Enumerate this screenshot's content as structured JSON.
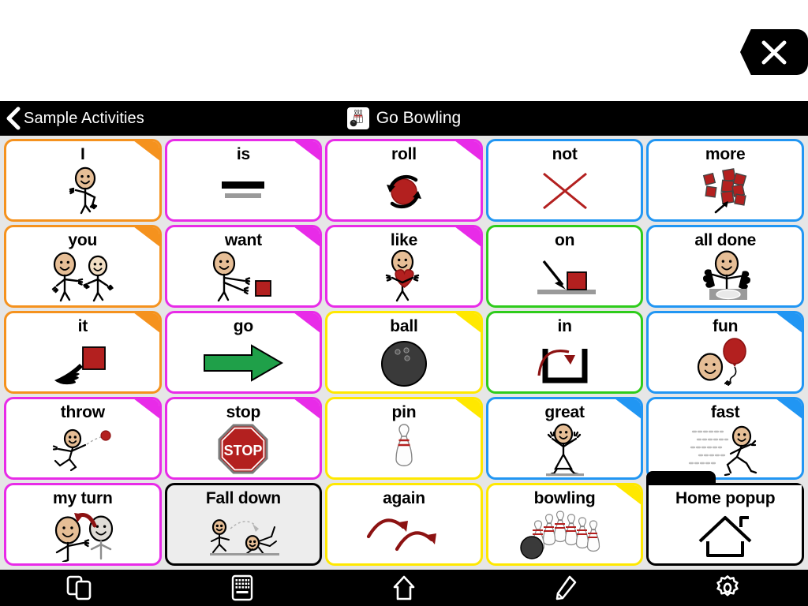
{
  "window": {
    "close_label": "close-icon"
  },
  "header": {
    "back_label": "Sample Activities",
    "back_icon": "chevron-left-icon",
    "title": "Go Bowling",
    "title_icon": "bowling-pins-icon"
  },
  "colors": {
    "orange": "#F5921E",
    "magenta": "#E82BE8",
    "blue": "#2196F3",
    "green": "#2ECC1B",
    "yellow": "#FFE800",
    "black": "#000000",
    "page_background": "#E6E6E6",
    "red": "#B3201F",
    "dark_red": "#8C1212"
  },
  "grid": {
    "rows": 5,
    "columns": 5,
    "cells": [
      {
        "label": "I",
        "border": "#F5921E",
        "fold": "#F5921E",
        "icon": "person-pointing-self-icon"
      },
      {
        "label": "is",
        "border": "#E82BE8",
        "fold": "#E82BE8",
        "icon": "equals-bars-icon"
      },
      {
        "label": "roll",
        "border": "#E82BE8",
        "fold": "#E82BE8",
        "icon": "rolling-ball-arrows-icon"
      },
      {
        "label": "not",
        "border": "#2196F3",
        "fold": null,
        "icon": "red-x-icon"
      },
      {
        "label": "more",
        "border": "#2196F3",
        "fold": null,
        "icon": "blocks-pile-arrow-icon"
      },
      {
        "label": "you",
        "border": "#F5921E",
        "fold": "#F5921E",
        "icon": "two-people-pointing-icon"
      },
      {
        "label": "want",
        "border": "#E82BE8",
        "fold": "#E82BE8",
        "icon": "person-reaching-block-icon"
      },
      {
        "label": "like",
        "border": "#E82BE8",
        "fold": "#E82BE8",
        "icon": "person-hugging-heart-icon"
      },
      {
        "label": "on",
        "border": "#2ECC1B",
        "fold": null,
        "icon": "arrow-onto-block-icon"
      },
      {
        "label": "all done",
        "border": "#2196F3",
        "fold": null,
        "icon": "person-hands-up-plate-icon"
      },
      {
        "label": "it",
        "border": "#F5921E",
        "fold": "#F5921E",
        "icon": "hand-pointing-block-icon"
      },
      {
        "label": "go",
        "border": "#E82BE8",
        "fold": "#E82BE8",
        "icon": "green-arrow-right-icon"
      },
      {
        "label": "ball",
        "border": "#FFE800",
        "fold": "#FFE800",
        "icon": "bowling-ball-icon"
      },
      {
        "label": "in",
        "border": "#2ECC1B",
        "fold": null,
        "icon": "arrow-into-container-icon"
      },
      {
        "label": "fun",
        "border": "#2196F3",
        "fold": "#2196F3",
        "icon": "face-balloon-icon"
      },
      {
        "label": "throw",
        "border": "#E82BE8",
        "fold": "#E82BE8",
        "icon": "person-throwing-ball-icon"
      },
      {
        "label": "stop",
        "border": "#E82BE8",
        "fold": "#E82BE8",
        "icon": "stop-sign-icon"
      },
      {
        "label": "pin",
        "border": "#FFE800",
        "fold": "#FFE800",
        "icon": "bowling-pin-icon"
      },
      {
        "label": "great",
        "border": "#2196F3",
        "fold": "#2196F3",
        "icon": "person-cheering-icon"
      },
      {
        "label": "fast",
        "border": "#2196F3",
        "fold": "#2196F3",
        "icon": "person-running-fast-icon"
      },
      {
        "label": "my turn",
        "border": "#E82BE8",
        "fold": null,
        "icon": "person-pointing-self-arrow-icon"
      },
      {
        "label": "Fall down",
        "border": "#000000",
        "fold": null,
        "icon": "person-falling-icon",
        "style": "pressed"
      },
      {
        "label": "again",
        "border": "#FFE800",
        "fold": null,
        "icon": "repeat-arrows-icon"
      },
      {
        "label": "bowling",
        "border": "#FFE800",
        "fold": "#FFE800",
        "icon": "bowling-pins-ball-icon"
      },
      {
        "label": "Home popup",
        "border": "#000000",
        "fold": null,
        "icon": "house-outline-icon",
        "style": "folder"
      }
    ]
  },
  "toolbar": {
    "items": [
      {
        "name": "pages-icon",
        "label": "Pages"
      },
      {
        "name": "keyboard-icon",
        "label": "Keyboard"
      },
      {
        "name": "home-icon",
        "label": "Home"
      },
      {
        "name": "pencil-icon",
        "label": "Edit"
      },
      {
        "name": "gear-icon",
        "label": "Settings"
      }
    ]
  }
}
